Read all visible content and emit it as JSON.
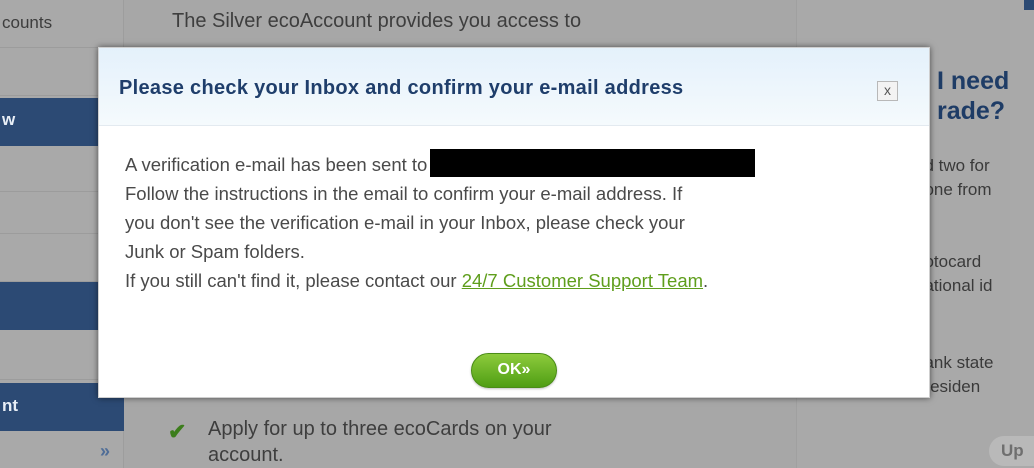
{
  "background": {
    "nav_items": {
      "accounts_label": "counts",
      "overview_label": "w",
      "account_label": "nt"
    },
    "center": {
      "intro_line": "The Silver ecoAccount provides you access to",
      "benefit_line1": "Apply for up to three ecoCards on your",
      "benefit_line2": "account."
    },
    "right_panel": {
      "heading_line1": "I need",
      "heading_line2": "rade?",
      "text_lines": [
        "ed two for",
        ", one from",
        "hotocard",
        "national id",
        "bank state",
        "f residen"
      ],
      "upgrade_label": "Up"
    }
  },
  "modal": {
    "title": "Please check your Inbox and confirm your e-mail address",
    "close_label": "x",
    "sent_text": "A verification e-mail has been sent to",
    "line2": "Follow the instructions in the email to confirm your e-mail address. If",
    "line3": "you don't see the verification e-mail in your Inbox, please check your",
    "line4": "Junk or Spam folders.",
    "line5_prefix": "If you still can't find it, please contact our ",
    "support_link": "24/7 Customer Support Team",
    "line5_suffix": ".",
    "ok_label": "OK»"
  },
  "colors": {
    "title": "#1f3e6b",
    "link": "#5f9e1c",
    "ok_button": "#6cb52a",
    "nav_active": "#2c4a74"
  }
}
